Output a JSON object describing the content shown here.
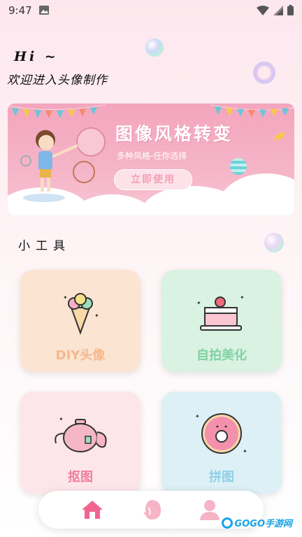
{
  "status_bar": {
    "time": "9:47"
  },
  "greeting": {
    "hi": "Hi ~",
    "welcome": "欢迎进入头像制作"
  },
  "banner": {
    "title": "图像风格转变",
    "subtitle": "多种风格-任你选择",
    "button_label": "立即使用"
  },
  "tools": {
    "section_title": "小工具",
    "items": [
      {
        "label": "DIY头像",
        "bg": "#fbe4d2",
        "color": "#f5b88b",
        "icon": "ice-cream-icon"
      },
      {
        "label": "自拍美化",
        "bg": "#d9f2e2",
        "color": "#7fd3a2",
        "icon": "cake-icon"
      },
      {
        "label": "抠图",
        "bg": "#fde6ea",
        "color": "#ef7f9a",
        "icon": "teapot-icon"
      },
      {
        "label": "拼图",
        "bg": "#ddf0f6",
        "color": "#8fd1e6",
        "icon": "donut-icon"
      }
    ]
  },
  "bottom_nav": {
    "items": [
      {
        "icon": "home-icon",
        "active": true
      },
      {
        "icon": "face-icon",
        "active": false
      },
      {
        "icon": "profile-icon",
        "active": false
      }
    ],
    "active_color": "#f0658f",
    "inactive_color": "#f6b4c6"
  },
  "watermark": {
    "text": "GOGO手游网"
  }
}
